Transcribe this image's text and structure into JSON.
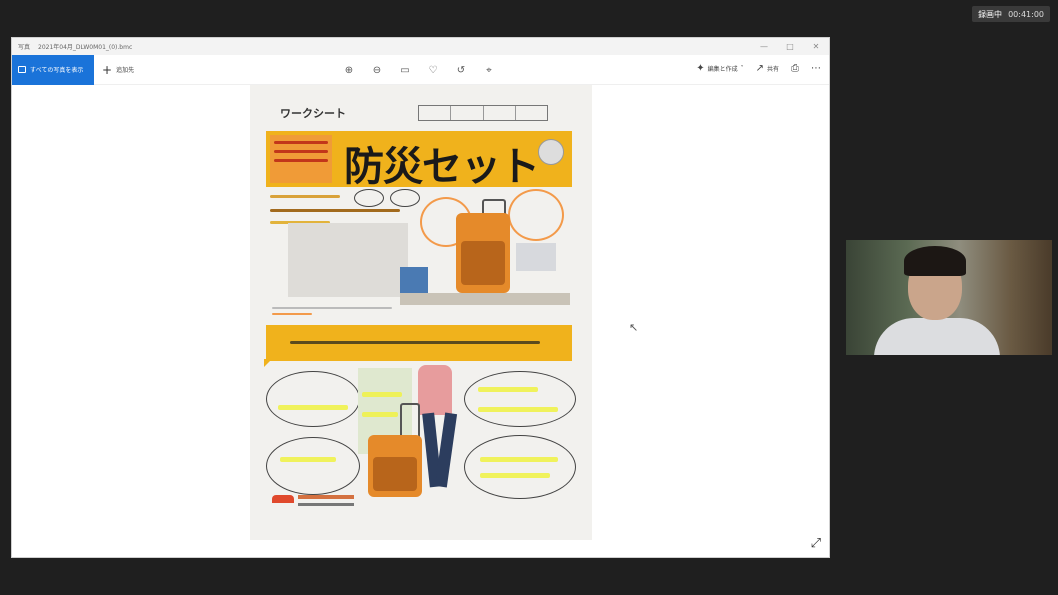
{
  "recording_badge": {
    "label": "録画中",
    "time": "00:41:00"
  },
  "window": {
    "app_name": "写真",
    "file_name": "2021年04月_DLW0M01_(0).bmc"
  },
  "toolbar": {
    "see_all_label": "すべての写真を表示",
    "add_to_label": "追加先",
    "edit_create_label": "編集と作成",
    "share_label": "共有"
  },
  "worksheet": {
    "header": "ワークシート",
    "title": "防災セット"
  },
  "colors": {
    "accent": "#1a73d9",
    "banner": "#f0b21c",
    "bag": "#e58a2a"
  }
}
